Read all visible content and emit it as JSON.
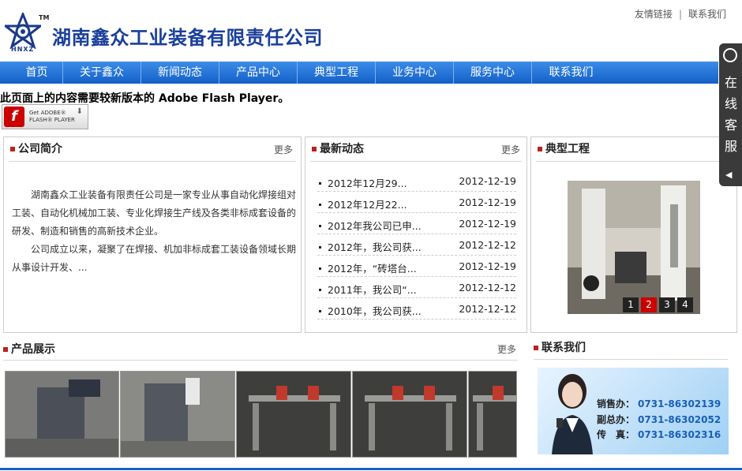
{
  "header": {
    "logo_abbr": "HNXZ",
    "logo_tm": "TM",
    "company_name": "湖南鑫众工业装备有限责任公司",
    "links": [
      "友情链接",
      "联系我们"
    ]
  },
  "nav": {
    "items": [
      "首页",
      "关于鑫众",
      "新闻动态",
      "产品中心",
      "典型工程",
      "业务中心",
      "服务中心",
      "联系我们"
    ]
  },
  "flash": {
    "message": "此页面上的内容需要较新版本的 Adobe Flash Player。",
    "button_get": "Get ADOBE®",
    "button_adobe": "ADOBE®",
    "button_product": "FLASH® PLAYER"
  },
  "intro": {
    "title": "公司简介",
    "more": "更多",
    "paragraph1": "湖南鑫众工业装备有限责任公司是一家专业从事自动化焊接组对工装、自动化机械加工装、专业化焊接生产线及各类非标成套设备的研发、制造和销售的高新技术企业。",
    "paragraph2": "公司成立以来，凝聚了在焊接、机加非标成套工装设备领域长期从事设计开发、..."
  },
  "news": {
    "title": "最新动态",
    "more": "更多",
    "items": [
      {
        "title": "2012年12月29...",
        "date": "2012-12-19"
      },
      {
        "title": "2012年12月22...",
        "date": "2012-12-19"
      },
      {
        "title": "2012年我公司已申...",
        "date": "2012-12-19"
      },
      {
        "title": "2012年，我公司获...",
        "date": "2012-12-12"
      },
      {
        "title": "2012年，“砖塔台...",
        "date": "2012-12-19"
      },
      {
        "title": "2011年，我公司“...",
        "date": "2012-12-12"
      },
      {
        "title": "2010年，我公司获...",
        "date": "2012-12-12"
      }
    ]
  },
  "projects": {
    "title": "典型工程",
    "more": "更多",
    "pages": [
      "1",
      "2",
      "3",
      "4"
    ],
    "active_page": "2"
  },
  "products": {
    "title": "产品展示",
    "more": "更多"
  },
  "contact": {
    "title": "联系我们",
    "lines": [
      {
        "label": "销售办：",
        "number": "0731-86302139"
      },
      {
        "label": "副总办：",
        "number": "0731-86302052"
      },
      {
        "label": "传　真：",
        "number": "0731-86302316"
      }
    ]
  },
  "side_service": {
    "text": "在线客服",
    "arrow": "◀"
  },
  "colors": {
    "brand_blue": "#1a3f9a",
    "nav_blue": "#2a78dc",
    "accent_red": "#b22222"
  }
}
